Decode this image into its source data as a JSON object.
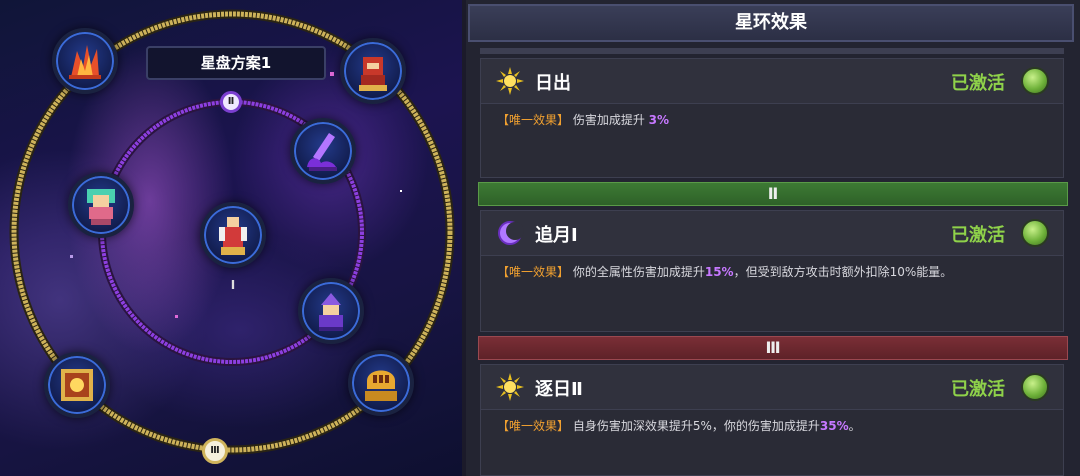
{
  "disc": {
    "plan_name": "星盘方案1",
    "ring_labels": {
      "outer": "Ⅲ",
      "middle": "Ⅱ",
      "inner": "Ⅰ"
    },
    "nodes": [
      {
        "name": "fire-claw-node",
        "icon": "fire-claw-icon"
      },
      {
        "name": "red-knight-node",
        "icon": "red-knight-icon"
      },
      {
        "name": "purple-sword-node",
        "icon": "purple-sword-icon"
      },
      {
        "name": "jade-priestess-node",
        "icon": "jade-priestess-icon"
      },
      {
        "name": "center-hero-node",
        "icon": "red-robe-hero-icon"
      },
      {
        "name": "violet-mage-node",
        "icon": "violet-mage-icon"
      },
      {
        "name": "golden-frame-node",
        "icon": "golden-frame-icon"
      },
      {
        "name": "golden-mask-node",
        "icon": "golden-mask-icon"
      }
    ]
  },
  "panel": {
    "title": "星环效果",
    "tiers": {
      "two": "Ⅱ",
      "three": "Ⅲ"
    },
    "effects": [
      {
        "icon": "sun-icon",
        "name": "日出",
        "status": "已激活",
        "tag": "【唯一效果】",
        "text_before": "伤害加成提升 ",
        "highlight": "3%",
        "text_after": ""
      },
      {
        "icon": "crescent-moon-icon",
        "name": "追月Ⅰ",
        "status": "已激活",
        "tag": "【唯一效果】",
        "text_before": "你的全属性伤害加成提升",
        "highlight": "15%",
        "text_after": "，但受到敌方攻击时额外扣除10%能量。"
      },
      {
        "icon": "sun-icon",
        "name": "逐日Ⅱ",
        "status": "已激活",
        "tag": "【唯一效果】",
        "text_before": "自身伤害加深效果提升5%，你的伤害加成提升",
        "highlight": "35%",
        "text_after": "。"
      }
    ]
  },
  "colors": {
    "active_green": "#8fd24a",
    "tag_orange": "#f0a030",
    "highlight_purple": "#c678ff",
    "outer_ring_gold": "#cdb25a",
    "inner_ring_purple": "#8d3fe0"
  }
}
